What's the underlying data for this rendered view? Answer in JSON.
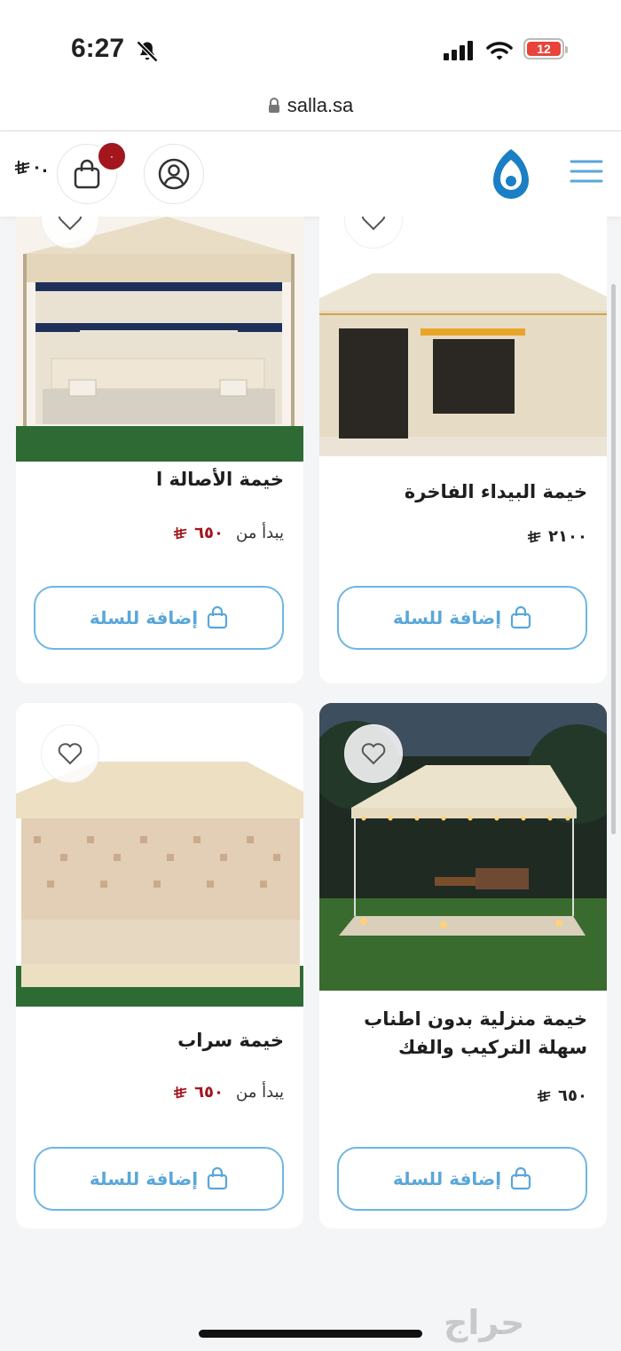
{
  "status_bar": {
    "time": "6:27",
    "battery_level": "12",
    "bell_icon": "bell-slash-icon",
    "signal_icon": "cellular-signal-icon",
    "wifi_icon": "wifi-icon"
  },
  "browser": {
    "url": "salla.sa",
    "lock_icon": "lock-icon"
  },
  "header": {
    "cart_total": "٠.",
    "cart_count": "٠",
    "icons": [
      "menu-icon",
      "logo",
      "account-icon",
      "shopping-bag-icon"
    ],
    "currency_symbol": "riyal-icon"
  },
  "products": [
    {
      "title": "خيمة الأصالة ا",
      "price_label": "يبدأ من",
      "price": "٦٥٠",
      "price_color": "#a3161d",
      "button_label": "إضافة للسلة"
    },
    {
      "title": "خيمة البيداء الفاخرة",
      "price_label": "",
      "price": "٢١٠٠",
      "price_color": "#222222",
      "button_label": "إضافة للسلة"
    },
    {
      "title": "خيمة سراب",
      "price_label": "يبدأ من",
      "price": "٦٥٠",
      "price_color": "#a3161d",
      "button_label": "إضافة للسلة"
    },
    {
      "title": "خيمة منزلية بدون اطناب سهلة التركيب والفك",
      "price_label": "",
      "price": "٦٥٠",
      "price_color": "#222222",
      "button_label": "إضافة للسلة"
    }
  ],
  "watermark": "حراج",
  "colors": {
    "accent": "#5aa7d8",
    "badge": "#a3161d",
    "logo": "#1a7fc4"
  }
}
